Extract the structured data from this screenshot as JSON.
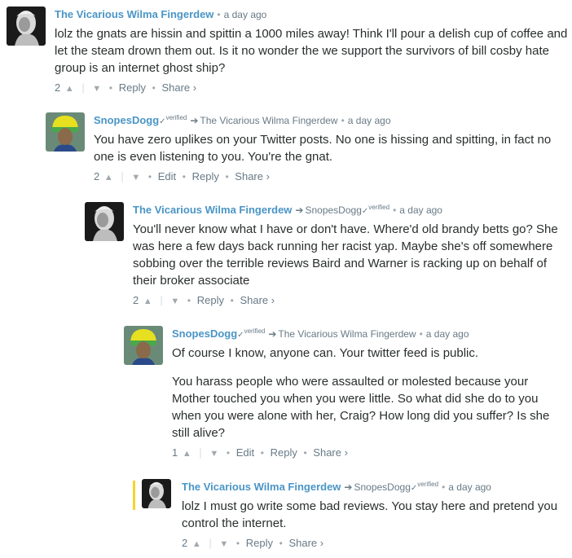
{
  "comments": [
    {
      "author": "The Vicarious Wilma Fingerdew",
      "verified": "",
      "reply_to": "",
      "reply_to_verified": "",
      "time": "a day ago",
      "paragraphs": [
        "lolz the gnats are hissin and spittin a 1000 miles away! Think I'll pour a delish cup of coffee and let the steam drown them out. Is it no wonder the we support the survivors of bill cosby hate group is an internet ghost ship?"
      ],
      "votes": "2",
      "actions": [
        "Reply",
        "Share ›"
      ],
      "avatar": "portrait-bw"
    },
    {
      "author": "SnopesDogg",
      "verified": "verified",
      "reply_to": "The Vicarious Wilma Fingerdew",
      "reply_to_verified": "",
      "time": "a day ago",
      "paragraphs": [
        "You have zero uplikes on your Twitter posts. No one is hissing and spitting, in fact no one is even listening to you. You're the gnat."
      ],
      "votes": "2",
      "actions": [
        "Edit",
        "Reply",
        "Share ›"
      ],
      "avatar": "snoop-green-hat"
    },
    {
      "author": "The Vicarious Wilma Fingerdew",
      "verified": "",
      "reply_to": "SnopesDogg",
      "reply_to_verified": "verified",
      "time": "a day ago",
      "paragraphs": [
        "You'll never know what I have or don't have. Where'd old brandy betts go? She was here a few days back running her racist yap. Maybe she's off somewhere sobbing over the terrible reviews Baird and Warner is racking up on behalf of their broker associate"
      ],
      "votes": "2",
      "actions": [
        "Reply",
        "Share ›"
      ],
      "avatar": "portrait-bw"
    },
    {
      "author": "SnopesDogg",
      "verified": "verified",
      "reply_to": "The Vicarious Wilma Fingerdew",
      "reply_to_verified": "",
      "time": "a day ago",
      "paragraphs": [
        "Of course I know, anyone can. Your twitter feed is public.",
        "You harass people who were assaulted or molested because your Mother touched you when you were little. So what did she do to you when you were alone with her, Craig? How long did you suffer? Is she still alive?"
      ],
      "votes": "1",
      "actions": [
        "Edit",
        "Reply",
        "Share ›"
      ],
      "avatar": "snoop-green-hat"
    },
    {
      "author": "The Vicarious Wilma Fingerdew",
      "verified": "",
      "reply_to": "SnopesDogg",
      "reply_to_verified": "verified",
      "time": "a day ago",
      "paragraphs": [
        "lolz I must go write some bad reviews. You stay here and pretend you control the internet."
      ],
      "votes": "2",
      "actions": [
        "Reply",
        "Share ›"
      ],
      "avatar": "portrait-bw",
      "highlight_color": "#f5d42c"
    }
  ]
}
